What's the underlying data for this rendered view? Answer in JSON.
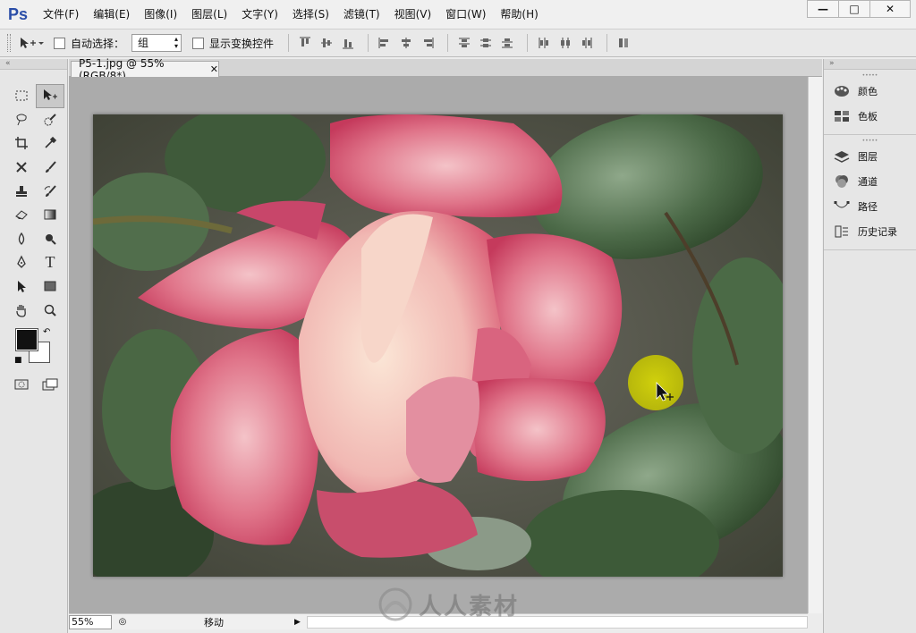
{
  "app": {
    "logo": "Ps"
  },
  "menu": [
    "文件(F)",
    "编辑(E)",
    "图像(I)",
    "图层(L)",
    "文字(Y)",
    "选择(S)",
    "滤镜(T)",
    "视图(V)",
    "窗口(W)",
    "帮助(H)"
  ],
  "window_controls": {
    "minimize": "—",
    "maximize": "□",
    "close": "✕"
  },
  "options_bar": {
    "auto_select_label": "自动选择：",
    "auto_select_checked": false,
    "auto_select_value": "组",
    "show_transform_label": "显示变换控件",
    "show_transform_checked": false
  },
  "document": {
    "tab_title": "P5-1.jpg @ 55%(RGB/8*)",
    "zoom": "55%",
    "status_text": "移动"
  },
  "tools": [
    "rectangular-marquee-icon",
    "move-icon",
    "lasso-icon",
    "quick-selection-icon",
    "crop-icon",
    "eyedropper-icon",
    "spot-healing-icon",
    "brush-icon",
    "clone-stamp-icon",
    "history-brush-icon",
    "eraser-icon",
    "gradient-icon",
    "blur-icon",
    "dodge-icon",
    "pen-icon",
    "type-icon",
    "path-selection-icon",
    "rectangle-shape-icon",
    "hand-icon",
    "zoom-icon"
  ],
  "colors": {
    "foreground": "#111111",
    "background": "#ffffff",
    "accent": "#2b4ea8"
  },
  "panels": {
    "group1": [
      {
        "icon": "color-palette-icon",
        "label": "颜色"
      },
      {
        "icon": "swatches-icon",
        "label": "色板"
      }
    ],
    "group2": [
      {
        "icon": "layers-icon",
        "label": "图层"
      },
      {
        "icon": "channels-icon",
        "label": "通道"
      },
      {
        "icon": "paths-icon",
        "label": "路径"
      },
      {
        "icon": "history-icon",
        "label": "历史记录"
      }
    ]
  },
  "watermark": {
    "text": "人人素材"
  }
}
